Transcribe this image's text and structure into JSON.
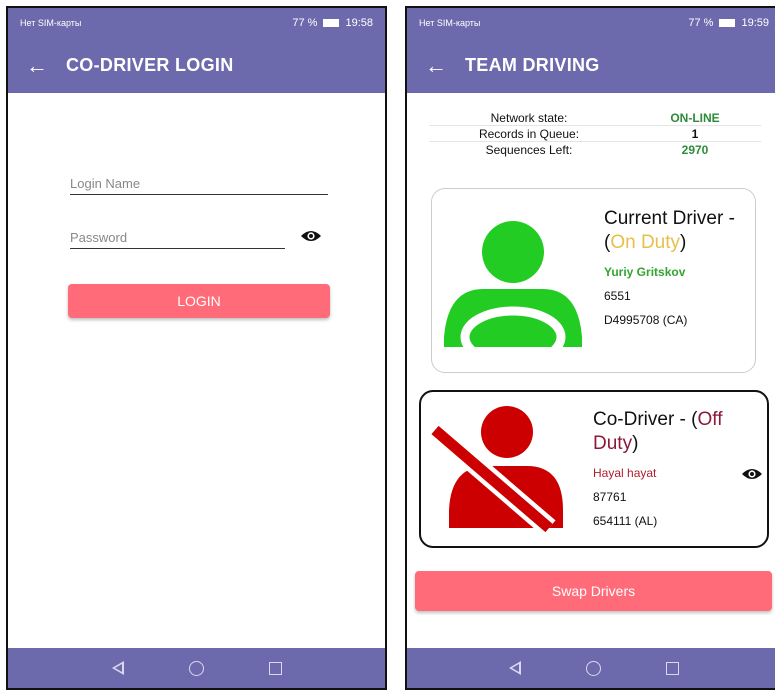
{
  "left": {
    "status": {
      "carrier": "Нет SIM-карты",
      "battery": "77 %",
      "time": "19:58"
    },
    "title": "CO-DRIVER LOGIN",
    "login_placeholder": "Login Name",
    "password_placeholder": "Password",
    "login_button": "LOGIN"
  },
  "right": {
    "status": {
      "carrier": "Нет SIM-карты",
      "battery": "77 %",
      "time": "19:59"
    },
    "title": "TEAM DRIVING",
    "network": [
      {
        "label": "Network state:",
        "value": "ON-LINE"
      },
      {
        "label": "Records in Queue:",
        "value": "1"
      },
      {
        "label": "Sequences Left:",
        "value": "2970"
      }
    ],
    "current_driver": {
      "heading": "Current Driver - (",
      "status": "On Duty",
      "close": ")",
      "name": "Yuriy Gritskov",
      "id": "6551",
      "license": "D4995708 (CA)"
    },
    "co_driver": {
      "heading": "Co-Driver - (",
      "status": "Off Duty",
      "close": ")",
      "name": "Hayal hayat",
      "id": "87761",
      "license": "654111 (AL)"
    },
    "swap_button": "Swap Drivers"
  },
  "colors": {
    "appbar": "#6c6aad",
    "button": "#ff6b78",
    "on_duty_icon": "#22cc22",
    "off_duty_icon": "#cc0000"
  },
  "icons": [
    "back-arrow-icon",
    "eye-icon",
    "driver-wheel-icon",
    "seatbelt-driver-icon",
    "wifi-icon",
    "location-icon"
  ]
}
